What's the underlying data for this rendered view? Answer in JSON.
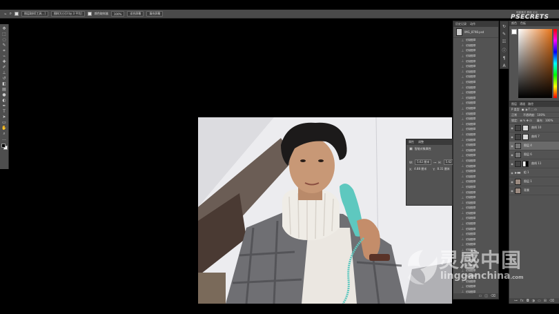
{
  "options_bar": {
    "sample_all_layers": "图层取样[工具...]",
    "size": "图样大小[3 by 3 平均]",
    "transform_label": "颜色取样器",
    "zoom": "100%",
    "fit_button": "适合屏幕",
    "fill_button": "填充屏幕"
  },
  "tools": [
    {
      "icon": "move-icon",
      "glyph": "✥"
    },
    {
      "icon": "marquee-icon",
      "glyph": "⬚"
    },
    {
      "icon": "lasso-icon",
      "glyph": "◌"
    },
    {
      "icon": "quick-select-icon",
      "glyph": "✎"
    },
    {
      "icon": "crop-icon",
      "glyph": "⌗"
    },
    {
      "icon": "eyedropper-icon",
      "glyph": "⌁"
    },
    {
      "icon": "healing-icon",
      "glyph": "✚"
    },
    {
      "icon": "brush-icon",
      "glyph": "✐"
    },
    {
      "icon": "stamp-icon",
      "glyph": "⊥"
    },
    {
      "icon": "history-brush-icon",
      "glyph": "↺"
    },
    {
      "icon": "eraser-icon",
      "glyph": "◧"
    },
    {
      "icon": "gradient-icon",
      "glyph": "▤"
    },
    {
      "icon": "blur-icon",
      "glyph": "●"
    },
    {
      "icon": "dodge-icon",
      "glyph": "◐"
    },
    {
      "icon": "pen-icon",
      "glyph": "✒"
    },
    {
      "icon": "type-icon",
      "glyph": "T"
    },
    {
      "icon": "path-select-icon",
      "glyph": "➤"
    },
    {
      "icon": "shape-icon",
      "glyph": "▭"
    },
    {
      "icon": "hand-icon",
      "glyph": "✋"
    },
    {
      "icon": "zoom-icon",
      "glyph": "⌕"
    },
    {
      "icon": "more-tools-icon",
      "glyph": "…"
    }
  ],
  "history": {
    "tab_history": "历史记录",
    "tab_actions": "动作",
    "snapshot_name": "IMG_8798.psd",
    "items": [
      "仿制图章",
      "仿制图章",
      "仿制图章",
      "仿制图章",
      "仿制图章",
      "仿制图章",
      "仿制图章",
      "仿制图章",
      "仿制图章",
      "仿制图章",
      "仿制图章",
      "仿制图章",
      "仿制图章",
      "仿制图章",
      "仿制图章",
      "仿制图章",
      "仿制图章",
      "仿制图章",
      "仿制图章",
      "仿制图章",
      "仿制图章",
      "仿制图章",
      "仿制图章",
      "仿制图章",
      "仿制图章",
      "仿制图章",
      "仿制图章",
      "仿制图章",
      "仿制图章",
      "仿制图章",
      "仿制图章",
      "仿制图章",
      "仿制图章",
      "仿制图章",
      "仿制图章",
      "仿制图章",
      "仿制图章",
      "仿制图章",
      "仿制图章",
      "仿制图章",
      "仿制图章",
      "仿制图章",
      "仿制图章",
      "仿制图章",
      "仿制图章",
      "仿制图章",
      "仿制图章",
      "仿制图章",
      "仿制图章",
      "仿制图章"
    ]
  },
  "properties": {
    "tab_properties": "属性",
    "tab_adjust": "调整",
    "title": "智能对象属性",
    "w_label": "W:",
    "w_value": "5.62 厘米",
    "h_label": "H:",
    "h_value": "5.62 厘米",
    "x_label": "X:",
    "x_value": "4.88 厘米",
    "y_label": "Y:",
    "y_value": "8.31 厘米"
  },
  "color_panel": {
    "tab_color": "颜色",
    "tab_swatches": "色板",
    "hue_base": "#e8751a"
  },
  "layers": {
    "tab_layers": "图层",
    "tab_channels": "通道",
    "tab_paths": "路径",
    "filter": "P 类型",
    "blend_mode": "正常",
    "opacity_label": "不透明度:",
    "opacity": "100%",
    "lock_label": "锁定:",
    "fill_label": "填充:",
    "fill": "100%",
    "items": [
      {
        "name": "曲线 10",
        "thumb": "adjust",
        "selected": false
      },
      {
        "name": "曲线 7",
        "thumb": "adjust",
        "selected": false
      },
      {
        "name": "图层 4",
        "thumb": "dark",
        "selected": true
      },
      {
        "name": "图层 6",
        "thumb": "dark",
        "selected": false
      },
      {
        "name": "曲线 11",
        "thumb": "mask",
        "selected": false
      },
      {
        "name": "组 1",
        "thumb": "group",
        "selected": false
      },
      {
        "name": "图层 1",
        "thumb": "photo",
        "selected": false
      },
      {
        "name": "背景",
        "thumb": "photo",
        "selected": false
      }
    ]
  },
  "brand": {
    "site_cn": "明星素材 教程 论坛",
    "logo": "PSECRETS"
  },
  "watermark": {
    "chinese": "灵感中国",
    "url": "lingganchina",
    "tld": ".com"
  }
}
